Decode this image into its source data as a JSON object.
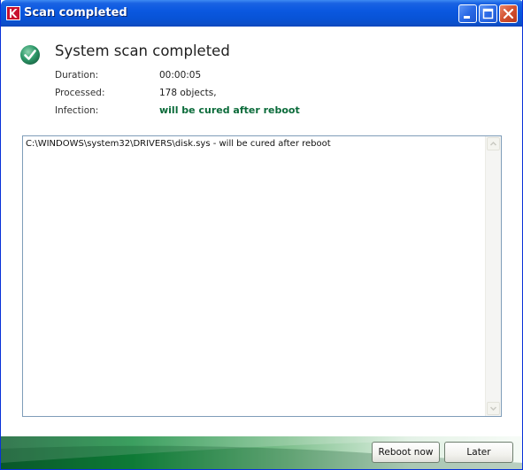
{
  "window": {
    "title": "Scan completed",
    "app_icon": "kaspersky-k-icon"
  },
  "titlebar_buttons": {
    "minimize": "minimize-icon",
    "maximize": "maximize-icon",
    "close": "close-icon"
  },
  "summary": {
    "heading": "System scan completed",
    "status_icon": "check-circle-icon",
    "rows": [
      {
        "label": "Duration:",
        "value": "00:00:05"
      },
      {
        "label": "Processed:",
        "value": "178 objects,"
      },
      {
        "label": "Infection:",
        "value": "will be cured after reboot"
      }
    ]
  },
  "log": {
    "lines": [
      "C:\\WINDOWS\\system32\\DRIVERS\\disk.sys - will be cured after reboot"
    ]
  },
  "buttons": {
    "reboot_now": "Reboot now",
    "later": "Later"
  },
  "colors": {
    "titlebar": "#0853d6",
    "infection_text": "#0b6b3a",
    "footer_green": "#108a3c"
  }
}
